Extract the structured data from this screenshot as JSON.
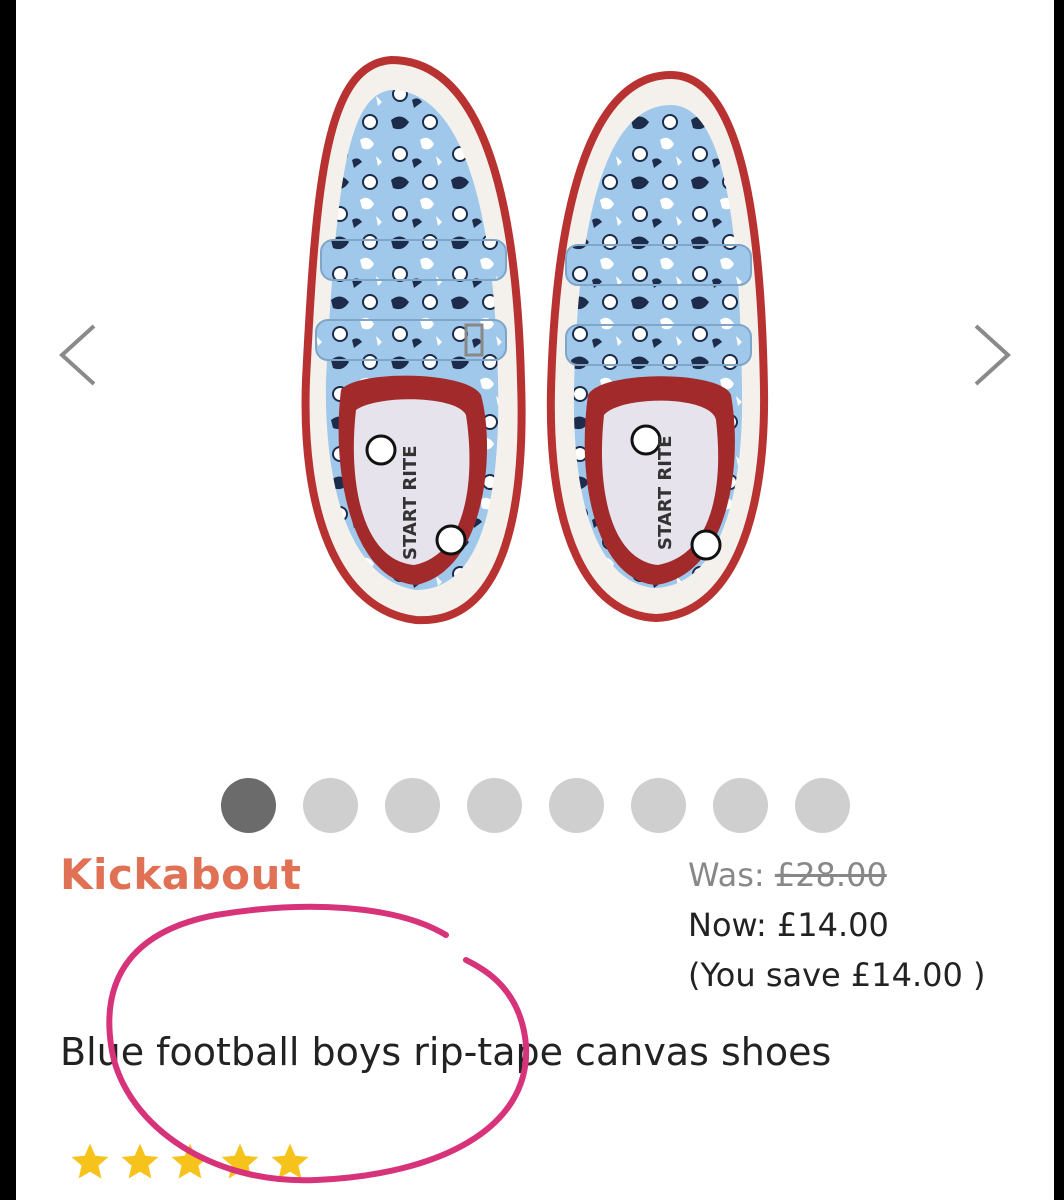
{
  "carousel": {
    "prev_label": "previous image",
    "next_label": "next image",
    "image_count": 8,
    "active_index": 0,
    "insole_print": "START RITE"
  },
  "product": {
    "brand": "Kickabout",
    "title": "Blue football boys rip-tape canvas shoes",
    "rating": 5
  },
  "pricing": {
    "was_label": "Was:",
    "was_amount": "£28.00",
    "now_label": "Now:",
    "now_amount": "£14.00",
    "save_text": "(You save £14.00 )"
  },
  "colors": {
    "brand": "#e07155",
    "star": "#f6c21c",
    "annotation": "#d6337a",
    "canvas": "#9fc8ea",
    "sole_trim": "#b83232"
  }
}
